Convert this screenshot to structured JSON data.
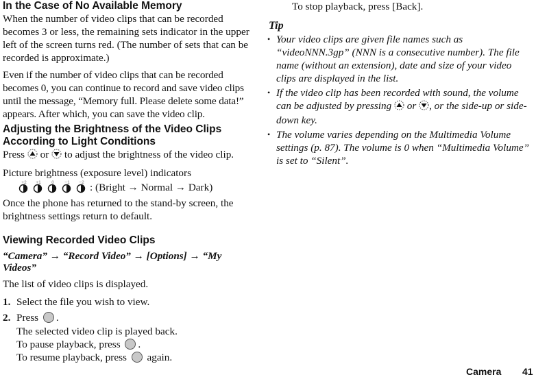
{
  "left": {
    "section1": {
      "heading": "In the Case of No Available Memory",
      "para1": "When the number of video clips that can be recorded becomes 3 or less, the remaining sets indicator in the upper left of the screen turns red. (The number of sets that can be recorded is approximate.)",
      "para2": "Even if the number of video clips that can be recorded becomes 0, you can continue to record and save video clips until the message, “Memory full. Please delete some data!” appears. After which, you can save the video clip."
    },
    "section2": {
      "heading_line1": "Adjusting the Brightness of the Video Clips",
      "heading_line2": "According to Light Conditions",
      "press_prefix": "Press",
      "press_or": "or",
      "press_suffix": "to adjust the brightness of the video clip.",
      "indicators_label": "Picture brightness (exposure level) indicators",
      "levels": [
        "+2",
        "+1",
        "0",
        "-1",
        "-2"
      ],
      "indicators_desc": ": (Bright → Normal → Dark)",
      "para_default": "Once the phone has returned to the stand-by screen, the brightness settings return to default."
    },
    "section3": {
      "heading": "Viewing Recorded Video Clips",
      "path_line1": "“Camera” → “Record Video” → [Options] → “My",
      "path_line2": "Videos”",
      "list_displayed": "The list of video clips is displayed.",
      "steps": [
        {
          "num": "1.",
          "text": "Select the file you wish to view."
        },
        {
          "num": "2.",
          "text_prefix": "Press",
          "text_suffix": "."
        }
      ],
      "step2_detail": {
        "line1": "The selected video clip is played back.",
        "pause_prefix": "To pause playback, press",
        "pause_suffix": ".",
        "resume_prefix": "To resume playback, press",
        "resume_suffix": "again."
      }
    }
  },
  "right": {
    "stop_line": "To stop playback, press [Back].",
    "tip_heading": "Tip",
    "tips": [
      {
        "text": "Your video clips are given file names such as “videoNNN.3gp” (NNN is a consecutive number). The file name (without an extension), date and size of your video clips are displayed in the list."
      },
      {
        "prefix": "If the video clip has been recorded with sound, the volume can be adjusted by pressing",
        "or": "or",
        "suffix": ", or the side-up or side-down key."
      },
      {
        "text": "The volume varies depending on the Multimedia Volume settings (p. 87). The volume is 0 when “Multimedia Volume” is set to “Silent”."
      }
    ]
  },
  "footer": {
    "section": "Camera",
    "page": "41"
  }
}
